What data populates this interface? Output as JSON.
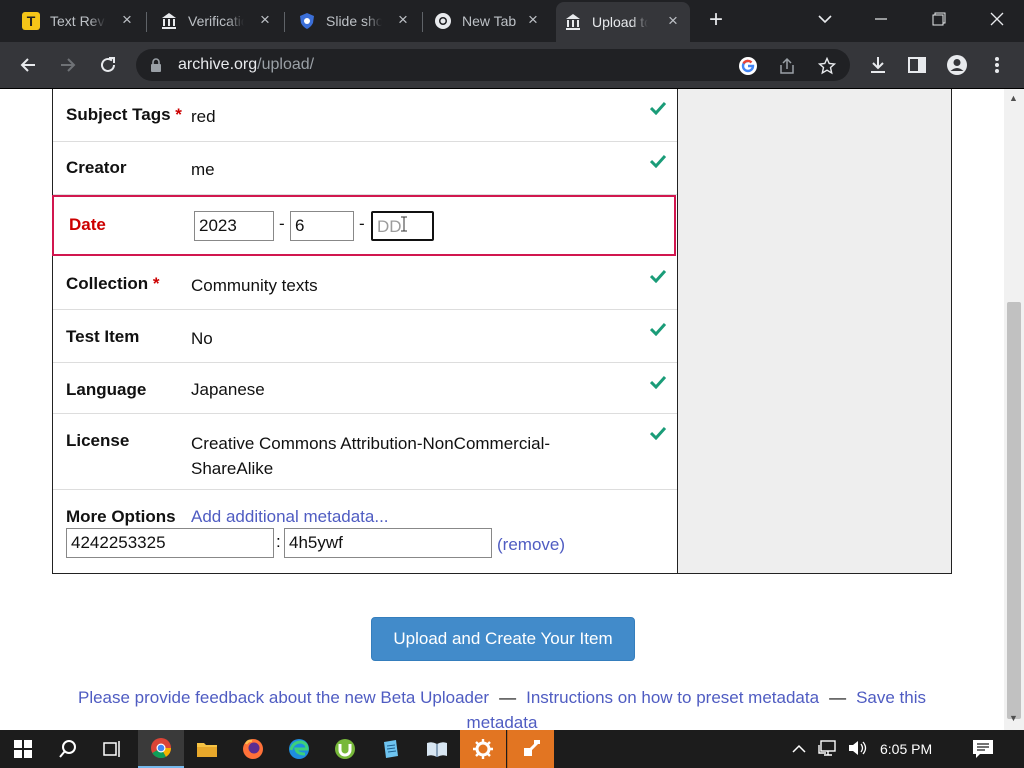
{
  "browser": {
    "tabs": [
      {
        "title": "Text Review",
        "icon": "t-logo-icon",
        "active": false
      },
      {
        "title": "Verification",
        "icon": "library-icon",
        "active": false
      },
      {
        "title": "Slide show",
        "icon": "shield-icon",
        "active": false
      },
      {
        "title": "New Tab",
        "icon": "chrome-icon",
        "active": false
      },
      {
        "title": "Upload to Internet Archive",
        "icon": "library-icon",
        "active": true
      }
    ],
    "url_host": "archive.org",
    "url_path": "/upload/"
  },
  "form": {
    "subject_tags": {
      "label": "Subject Tags",
      "required_mark": "*",
      "value": "red"
    },
    "creator": {
      "label": "Creator",
      "value": "me"
    },
    "date": {
      "label": "Date",
      "year": "2023",
      "month": "6",
      "day_placeholder": "DD",
      "separator": "-"
    },
    "collection": {
      "label": "Collection",
      "required_mark": "*",
      "value": "Community texts"
    },
    "test_item": {
      "label": "Test Item",
      "value": "No"
    },
    "language": {
      "label": "Language",
      "value": "Japanese"
    },
    "license": {
      "label": "License",
      "value_line1": "Creative Commons Attribution-NonCommercial-",
      "value_line2": "ShareAlike"
    },
    "more_options": {
      "label": "More Options",
      "link": "Add additional metadata...",
      "key": "4242253325",
      "colon": ":",
      "value": "4h5ywf",
      "remove": "(remove)"
    }
  },
  "submit_button": "Upload and Create Your Item",
  "footer": {
    "feedback": "Please provide feedback about the new Beta Uploader",
    "sep": "—",
    "instructions": "Instructions on how to preset metadata",
    "save": "Save this metadata"
  },
  "taskbar": {
    "time": "6:05 PM",
    "apps": [
      "chrome-icon",
      "file-explorer-icon",
      "firefox-icon",
      "edge-icon",
      "utorrent-icon",
      "notepad-icon",
      "book-icon",
      "settings-icon",
      "editor-icon"
    ]
  },
  "colors": {
    "accent_blue": "#428bca",
    "link": "#4f5cc2",
    "check_green": "#1a9c78",
    "error_red": "#cc0000",
    "error_border": "#d1174f"
  }
}
